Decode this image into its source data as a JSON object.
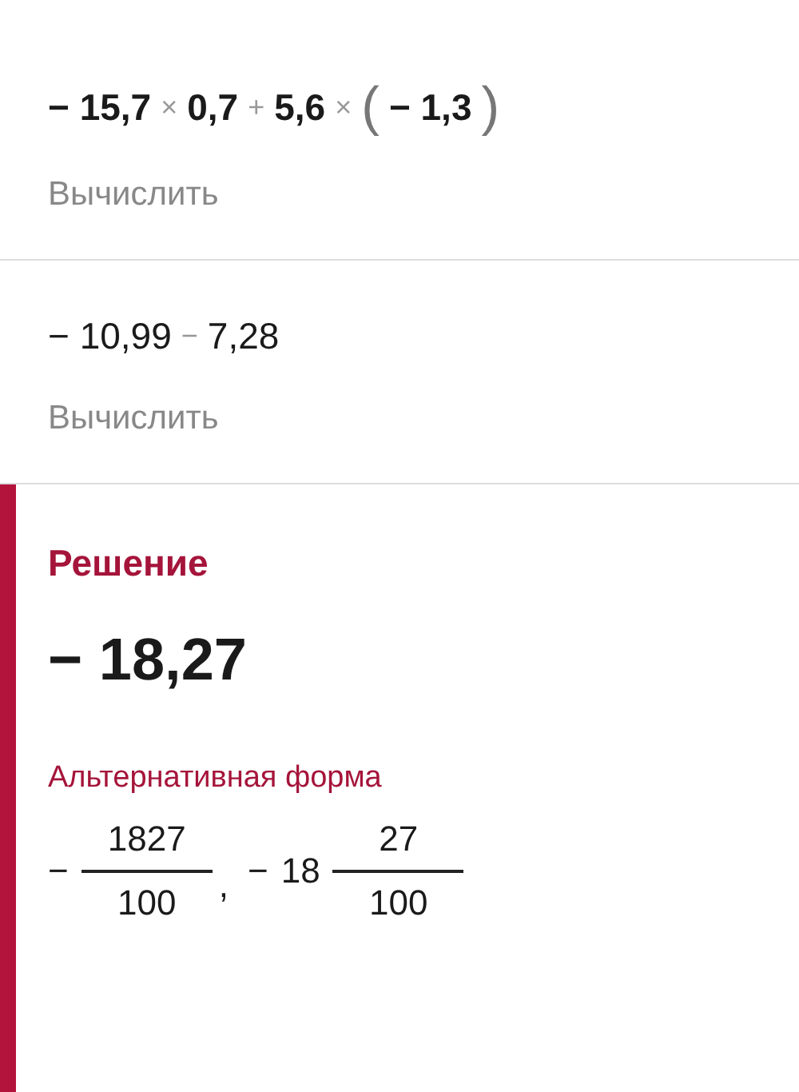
{
  "steps": [
    {
      "bold": true,
      "action": "Вычислить",
      "tokens": [
        {
          "kind": "num",
          "text": "− 15,7"
        },
        {
          "kind": "op",
          "text": "×"
        },
        {
          "kind": "num",
          "text": "0,7"
        },
        {
          "kind": "op",
          "text": "+"
        },
        {
          "kind": "num",
          "text": "5,6"
        },
        {
          "kind": "op",
          "text": "×"
        },
        {
          "kind": "paren",
          "text": "("
        },
        {
          "kind": "num",
          "text": "− 1,3"
        },
        {
          "kind": "paren",
          "text": ")"
        }
      ]
    },
    {
      "bold": false,
      "action": "Вычислить",
      "tokens": [
        {
          "kind": "num",
          "text": "− 10,99"
        },
        {
          "kind": "op",
          "text": "−"
        },
        {
          "kind": "num",
          "text": "7,28"
        }
      ]
    }
  ],
  "solution": {
    "title": "Решение",
    "result": "− 18,27",
    "alt_title": "Альтернативная форма",
    "alternatives": [
      {
        "sign": "−",
        "numerator": "1827",
        "denominator": "100"
      },
      {
        "sign": "−",
        "whole": "18",
        "numerator": "27",
        "denominator": "100"
      }
    ],
    "separator": ","
  }
}
